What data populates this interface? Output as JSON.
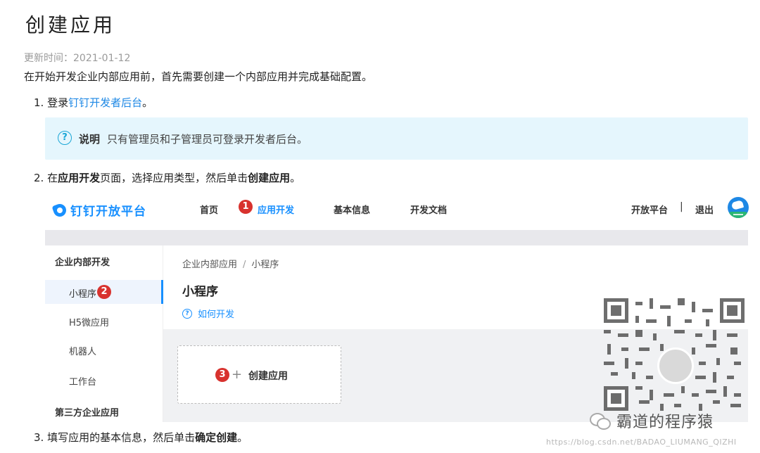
{
  "doc": {
    "title": "创建应用",
    "updated_label": "更新时间：",
    "updated_date": "2021-01-12",
    "intro": "在开始开发企业内部应用前，首先需要创建一个内部应用并完成基础配置。",
    "step1": {
      "num": "1.",
      "pre": "登录",
      "link": "钉钉开发者后台",
      "post": "。"
    },
    "note": {
      "label": "说明",
      "text": "只有管理员和子管理员可登录开发者后台。"
    },
    "step2": {
      "num": "2.",
      "pre": "在",
      "b1": "应用开发",
      "mid": "页面，选择应用类型，然后单击",
      "b2": "创建应用",
      "post": "。"
    },
    "step3": {
      "num": "3.",
      "pre": "填写应用的基本信息，然后单击",
      "b1": "确定创建",
      "post": "。"
    }
  },
  "screenshot": {
    "logo": "钉钉开放平台",
    "nav": [
      "首页",
      "应用开发",
      "基本信息",
      "开发文档"
    ],
    "right_links": [
      "开放平台",
      "|",
      "退出"
    ],
    "sidebar": {
      "group1": "企业内部开发",
      "items": [
        "小程序",
        "H5微应用",
        "机器人",
        "工作台"
      ],
      "group2": "第三方企业应用"
    },
    "breadcrumb": [
      "企业内部应用",
      "/",
      "小程序"
    ],
    "page_title": "小程序",
    "howto": "如何开发",
    "create_label": "创建应用",
    "markers": [
      "1",
      "2",
      "3"
    ]
  },
  "watermark": {
    "name": "霸道的程序猿",
    "url": "https://blog.csdn.net/BADAO_LIUMANG_QIZHI"
  },
  "colors": {
    "link": "#1e88e5",
    "note_bg": "#e5f6fd",
    "marker": "#d8322e"
  }
}
